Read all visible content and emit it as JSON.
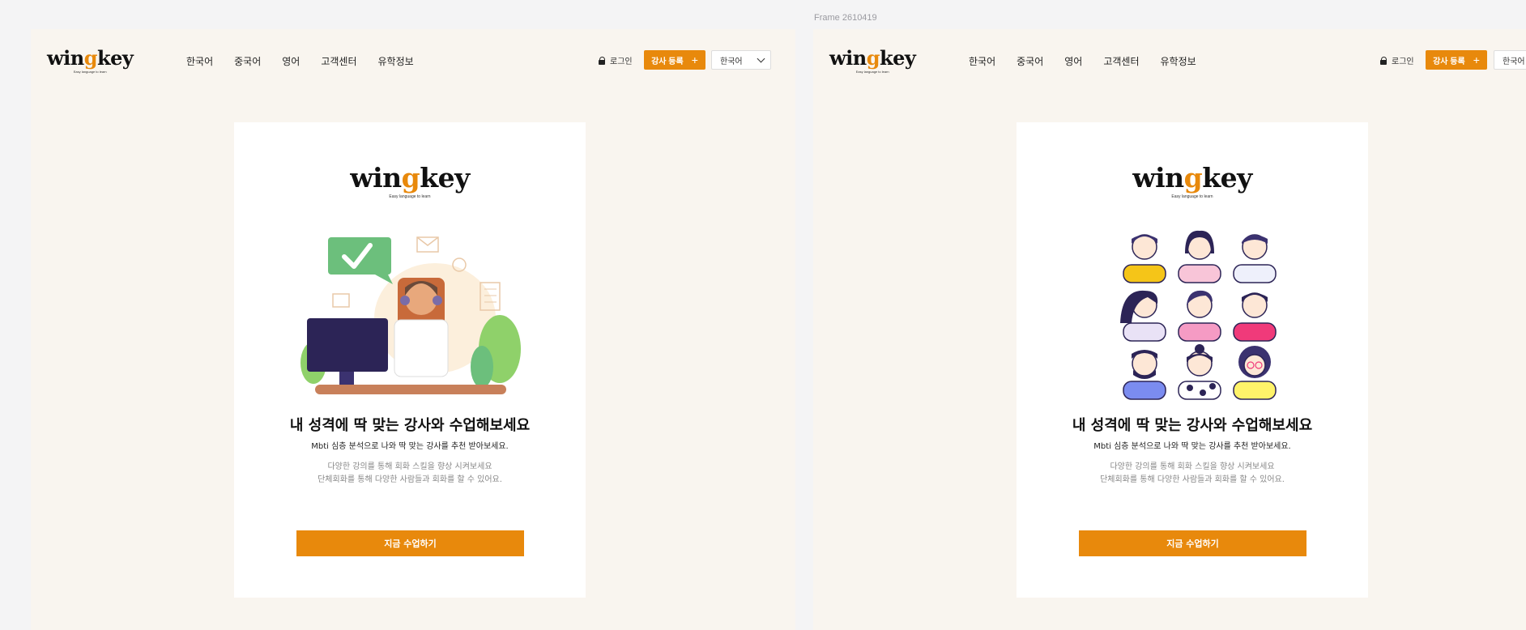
{
  "canvas": {
    "frame_label": "Frame 2610419"
  },
  "brand": {
    "logo_pre": "win",
    "logo_g": "g",
    "logo_post": "key",
    "tagline": "Easy language to learn",
    "accent": "#e8890c"
  },
  "header": {
    "nav": [
      "한국어",
      "중국어",
      "영어",
      "고객센터",
      "유학정보"
    ],
    "login_label": "로그인",
    "register_label": "강사 등록",
    "register_icon": "plus-icon",
    "language_selected": "한국어"
  },
  "card": {
    "headline": "내 성격에 딱 맞는 강사와 수업해보세요",
    "subtitle": "Mbti 심층 분석으로 나와 딱 맞는 강사를 추천 받아보세요.",
    "desc_line1": "다양한 강의를 통해 회화 스킬을 향상 시켜보세요",
    "desc_line2": "단체회화를 통해 다양한 사람들과 회화를 할 수 있어요.",
    "cta_label": "지금 수업하기"
  },
  "illustrations": {
    "frame1": "agent-at-computer-illustration",
    "frame2": "avatar-grid-illustration"
  },
  "colors": {
    "frame_bg": "#f9f5ef",
    "card_bg": "#ffffff",
    "cta": "#e8890c"
  }
}
